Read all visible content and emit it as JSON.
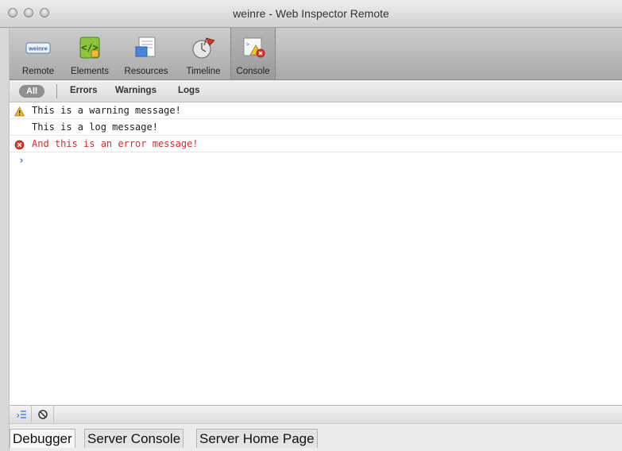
{
  "window": {
    "title": "weinre - Web Inspector Remote"
  },
  "toolbar": {
    "items": [
      {
        "label": "Remote",
        "icon": "weinre-logo-icon",
        "badge": "weinre"
      },
      {
        "label": "Elements",
        "icon": "elements-icon"
      },
      {
        "label": "Resources",
        "icon": "resources-icon"
      },
      {
        "label": "Timeline",
        "icon": "timeline-icon"
      },
      {
        "label": "Console",
        "icon": "console-icon",
        "active": true
      }
    ]
  },
  "filters": {
    "all": "All",
    "errors": "Errors",
    "warnings": "Warnings",
    "logs": "Logs"
  },
  "console": {
    "messages": [
      {
        "level": "warning",
        "text": "This is a warning message!",
        "icon": "warning-icon"
      },
      {
        "level": "log",
        "text": "This is a log message!"
      },
      {
        "level": "error",
        "text": "And this is an error message!",
        "icon": "error-icon"
      }
    ],
    "prompt": "›"
  },
  "status_bar": {
    "buttons": [
      {
        "icon": "console-toggle-icon"
      },
      {
        "icon": "clear-console-icon"
      }
    ]
  },
  "bottom_tabs": [
    {
      "label": "Debugger",
      "active": true
    },
    {
      "label": "Server Console"
    },
    {
      "label": "Server Home Page"
    }
  ],
  "colors": {
    "error_text": "#d82b2b",
    "warning_icon": "#e8b820",
    "prompt": "#2a6bd6"
  }
}
